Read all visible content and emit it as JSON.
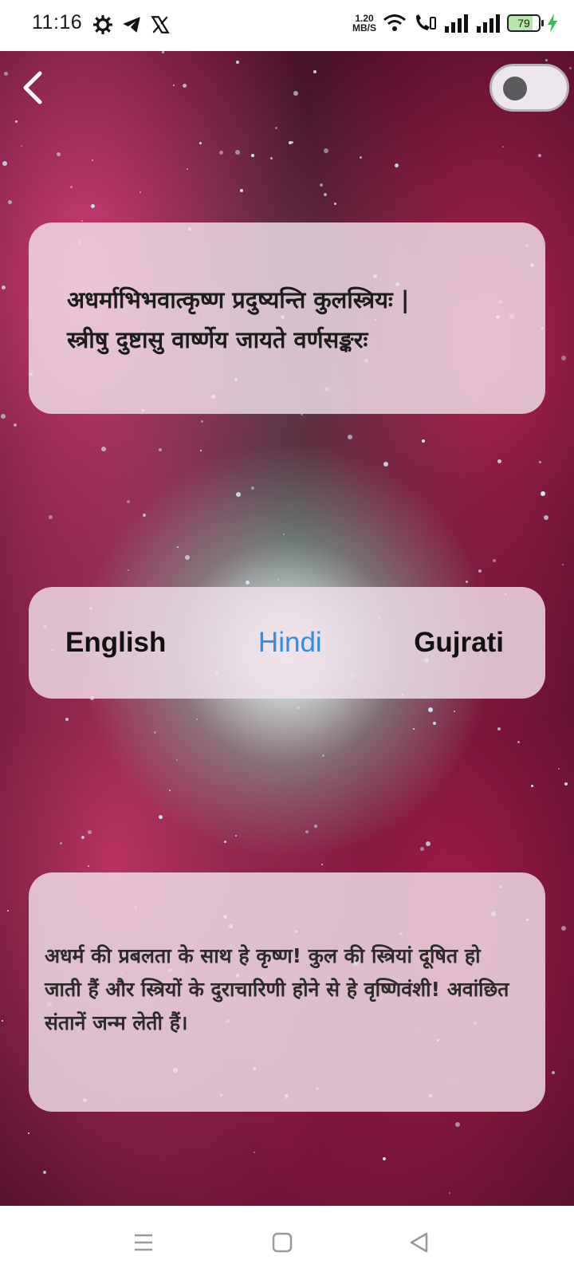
{
  "status_bar": {
    "time": "11:16",
    "net_speed_value": "1.20",
    "net_speed_unit": "MB/S",
    "battery_level": "79",
    "icons": [
      "settings-icon",
      "telegram-icon",
      "x-icon",
      "wifi-icon",
      "wifi-call-icon",
      "signal-icon",
      "signal-icon",
      "battery-icon",
      "charging-icon"
    ]
  },
  "header": {
    "back_icon": "chevron-left-icon",
    "theme_toggle_on": false
  },
  "verse": {
    "line1": "अधर्माभिभवात्कृष्ण प्रदुष्यन्ति कुलस्त्रियः |",
    "line2": "स्त्रीषु दुष्टासु वार्ष्णेय जायते वर्णसङ्करः"
  },
  "language_tabs": [
    {
      "label": "English",
      "active": false
    },
    {
      "label": "Hindi",
      "active": true
    },
    {
      "label": "Gujrati",
      "active": false
    }
  ],
  "translation": {
    "text": "अधर्म की प्रबलता के साथ हे कृष्ण! कुल की स्त्रियां दूषित हो जाती हैं और स्त्रियों के दुराचारिणी होने से हे वृष्णिवंशी! अवांछित संतानें जन्म लेती हैं।"
  },
  "colors": {
    "active_tab": "#2f8ee6",
    "card_bg": "#f0e1eb"
  },
  "nav_bar": {
    "icons": [
      "menu-icon",
      "home-icon",
      "back-icon"
    ]
  }
}
